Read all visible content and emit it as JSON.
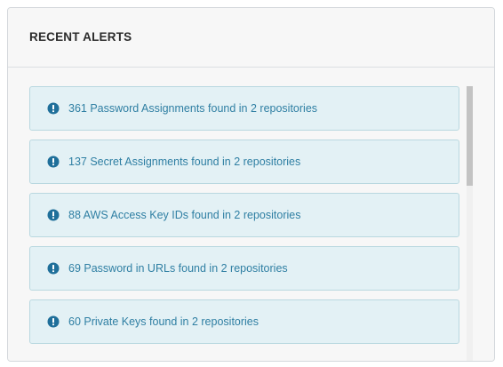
{
  "panel": {
    "title": "RECENT ALERTS"
  },
  "colors": {
    "alert_background": "#e3f1f5",
    "alert_border": "#b9d8e0",
    "alert_text": "#2f7fa3",
    "icon": "#1f6f9a"
  },
  "alerts": [
    {
      "icon": "exclamation-circle-icon",
      "text": "361 Password Assignments found in 2 repositories"
    },
    {
      "icon": "exclamation-circle-icon",
      "text": "137 Secret Assignments found in 2 repositories"
    },
    {
      "icon": "exclamation-circle-icon",
      "text": "88 AWS Access Key IDs found in 2 repositories"
    },
    {
      "icon": "exclamation-circle-icon",
      "text": "69 Password in URLs found in 2 repositories"
    },
    {
      "icon": "exclamation-circle-icon",
      "text": "60 Private Keys found in 2 repositories"
    }
  ]
}
